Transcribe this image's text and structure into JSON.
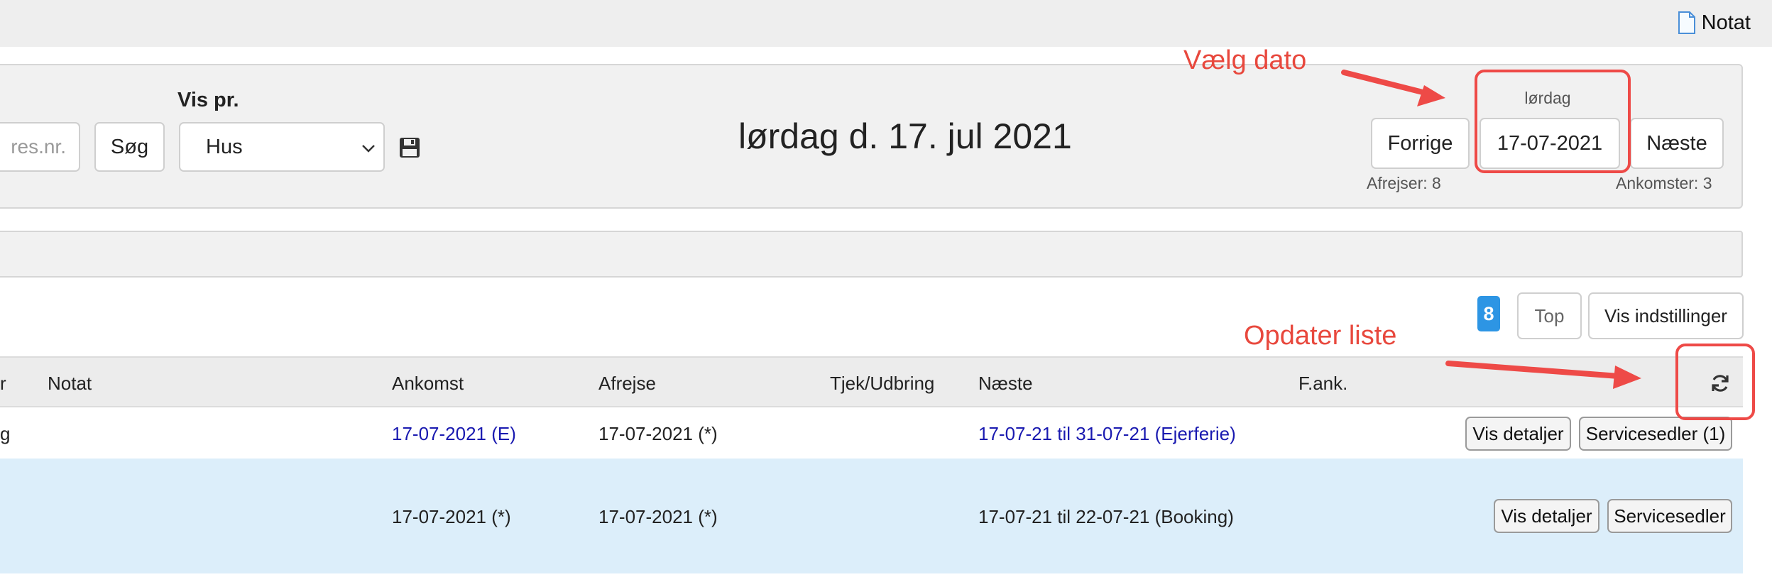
{
  "topbar": {
    "notat_label": "Notat"
  },
  "filter": {
    "res_placeholder": "res.nr.",
    "search_label": "Søg",
    "vis_pr_label": "Vis pr.",
    "vis_pr_selected": "Hus"
  },
  "date_nav": {
    "heading": "lørdag d. 17. jul 2021",
    "day_label": "lørdag",
    "date_value": "17-07-2021",
    "prev_label": "Forrige",
    "next_label": "Næste",
    "departures": "Afrejser: 8",
    "arrivals": "Ankomster: 3"
  },
  "controls": {
    "count": "8",
    "top_label": "Top",
    "settings_label": "Vis indstillinger"
  },
  "table": {
    "headers": {
      "partial": "r",
      "notat": "Notat",
      "ankomst": "Ankomst",
      "afrejse": "Afrejse",
      "tjek": "Tjek/Udbring",
      "naeste": "Næste",
      "fank": "F.ank."
    },
    "rows": [
      {
        "partial": "g",
        "ankomst": "17-07-2021 (E)",
        "afrejse": "17-07-2021 (*)",
        "naeste": "17-07-21 til 31-07-21 (Ejerferie)",
        "details_label": "Vis detaljer",
        "service_label": "Servicesedler (1)"
      },
      {
        "ankomst": "17-07-2021 (*)",
        "afrejse": "17-07-2021 (*)",
        "naeste": "17-07-21 til 22-07-21 (Booking)",
        "details_label": "Vis detaljer",
        "service_label": "Servicesedler"
      }
    ]
  },
  "annotations": {
    "date_note": "Vælg dato",
    "refresh_note": "Opdater liste",
    "color": "#e8483d"
  },
  "colors": {
    "badge": "#2d95e4",
    "row_highlight": "#dceefa",
    "link": "#1a1ab0"
  }
}
